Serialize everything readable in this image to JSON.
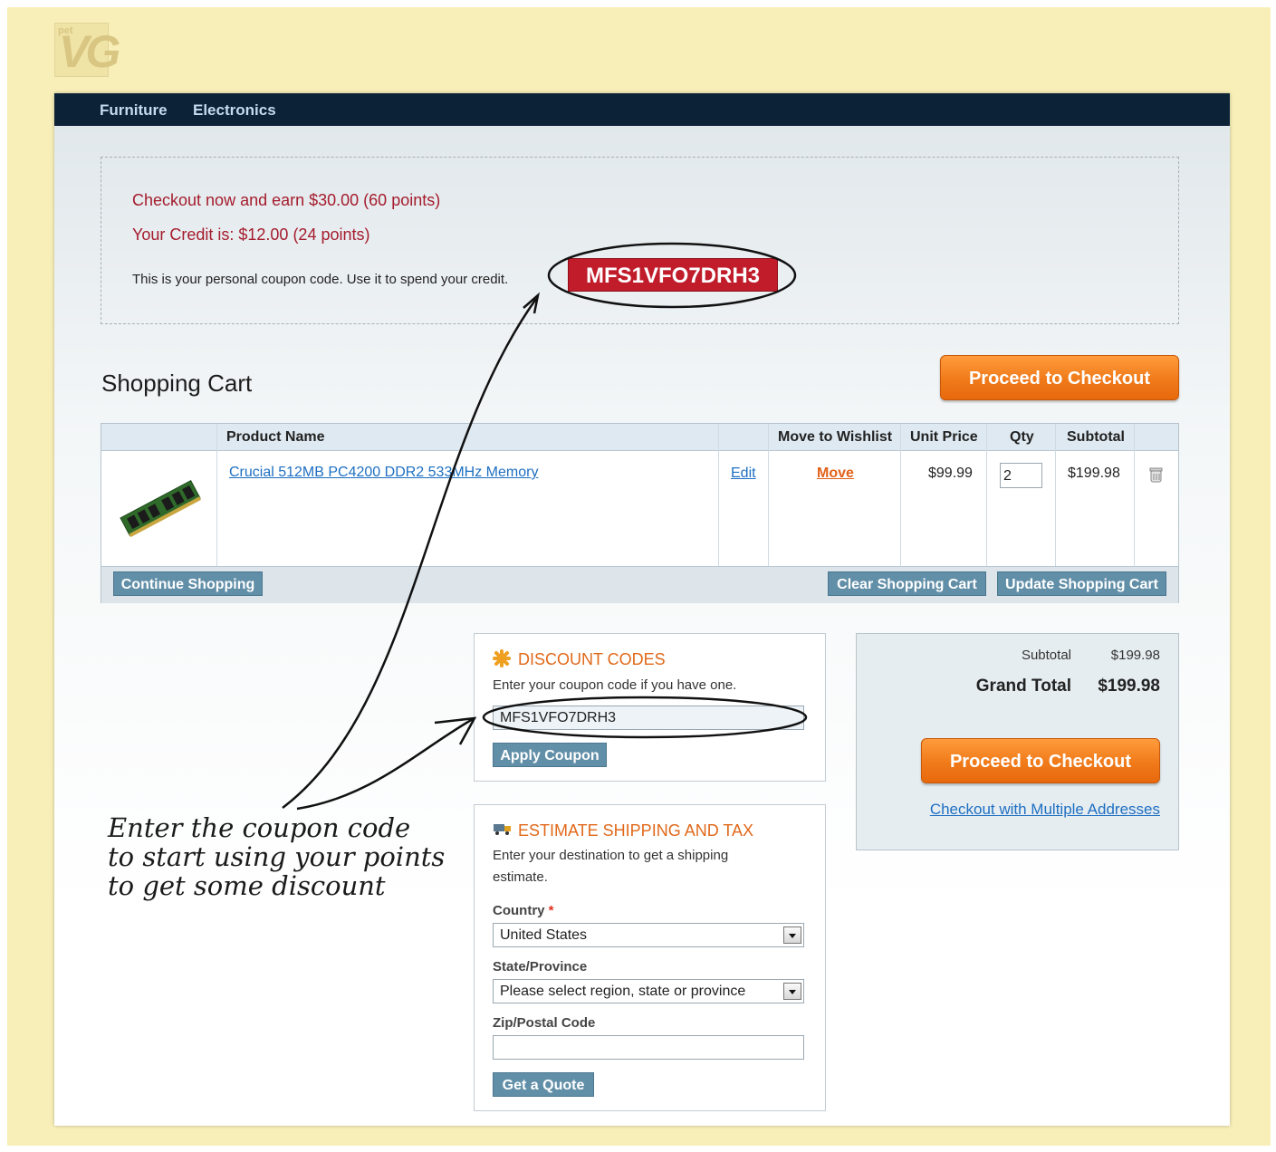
{
  "nav": {
    "items": [
      "Furniture",
      "Electronics"
    ]
  },
  "promo": {
    "earn": "Checkout now and earn $30.00 (60 points)",
    "credit": "Your Credit is: $12.00 (24 points)",
    "coupon_note": "This is your personal coupon code. Use it to spend your credit.",
    "coupon_code": "MFS1VFO7DRH3"
  },
  "cart": {
    "title": "Shopping Cart",
    "checkout_label": "Proceed to Checkout",
    "columns": [
      "Product Name",
      "Move to Wishlist",
      "Unit Price",
      "Qty",
      "Subtotal"
    ],
    "row": {
      "product": "Crucial 512MB PC4200 DDR2 533MHz Memory",
      "edit": "Edit",
      "move": "Move",
      "unit_price": "$99.99",
      "qty": "2",
      "subtotal": "$199.98"
    },
    "continue_label": "Continue Shopping",
    "clear_label": "Clear Shopping Cart",
    "update_label": "Update Shopping Cart"
  },
  "discount": {
    "title": "DISCOUNT CODES",
    "hint": "Enter your coupon code if you have one.",
    "value": "MFS1VFO7DRH3",
    "apply_label": "Apply Coupon"
  },
  "shipping": {
    "title": "ESTIMATE SHIPPING AND TAX",
    "hint_line1": "Enter your destination to get a shipping",
    "hint_line2": "estimate.",
    "country_label": "Country",
    "required_mark": "*",
    "country_value": "United States",
    "state_label": "State/Province",
    "state_value": "Please select region, state or province",
    "zip_label": "Zip/Postal Code",
    "zip_value": "",
    "quote_label": "Get a Quote"
  },
  "totals": {
    "subtotal_label": "Subtotal",
    "subtotal_value": "$199.98",
    "grand_label": "Grand Total",
    "grand_value": "$199.98",
    "checkout_label": "Proceed to Checkout",
    "multi_label": "Checkout with Multiple Addresses"
  },
  "annotation": {
    "line1": "Enter the coupon code",
    "line2": "to start using your points",
    "line3": "to get some discount"
  },
  "colors": {
    "nav_bg": "#0b2237",
    "accent_orange": "#f07a1a",
    "coupon_red": "#c01c2a",
    "frame_yellow": "#f8efb8"
  }
}
